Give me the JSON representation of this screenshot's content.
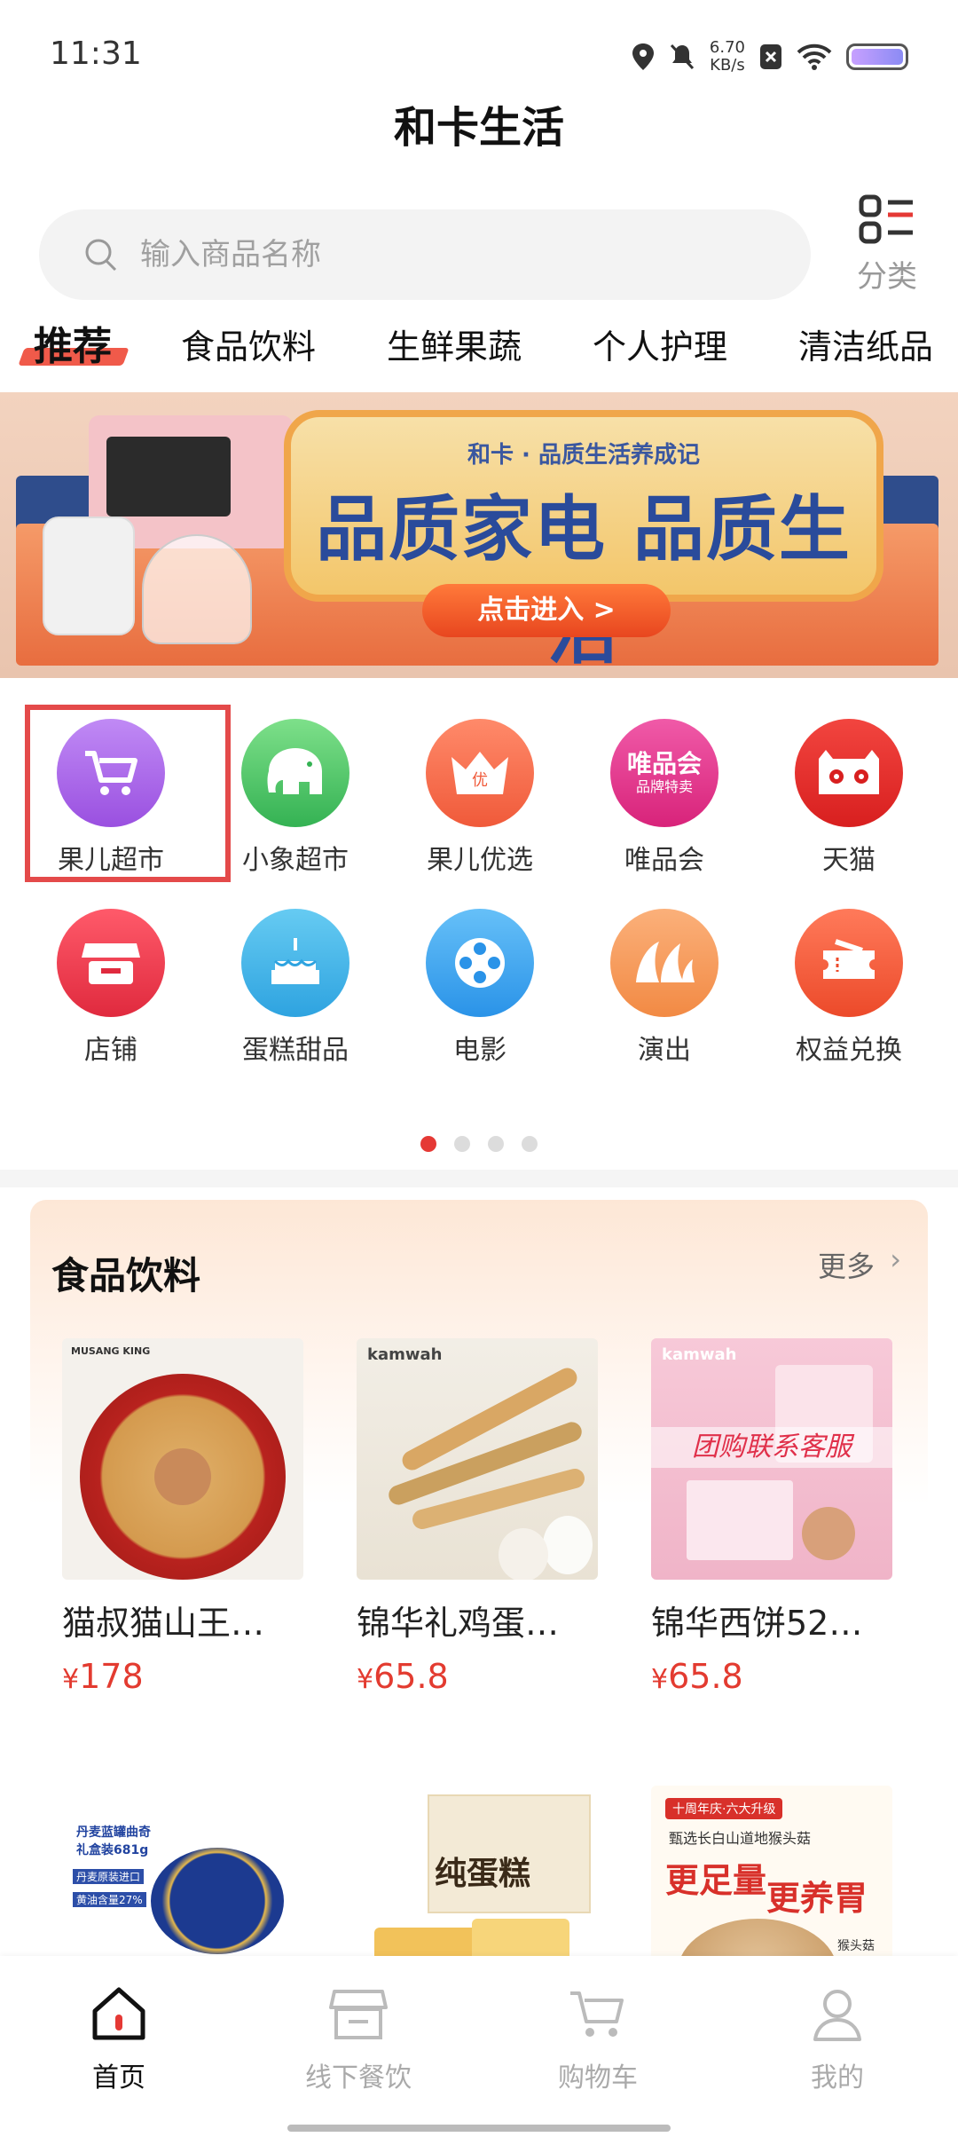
{
  "status_bar": {
    "time": "11:31",
    "speed_value": "6.70",
    "speed_unit": "KB/s"
  },
  "app": {
    "title": "和卡生活"
  },
  "search": {
    "placeholder": "输入商品名称"
  },
  "category_button": {
    "label": "分类"
  },
  "tabs": [
    {
      "label": "推荐",
      "active": true
    },
    {
      "label": "食品饮料"
    },
    {
      "label": "生鲜果蔬"
    },
    {
      "label": "个人护理"
    },
    {
      "label": "清洁纸品"
    }
  ],
  "banner": {
    "subtitle": "和卡 · 品质生活养成记",
    "headline": "品质家电 品质生活",
    "cta": "点击进入 >"
  },
  "grid": [
    {
      "label": "果儿超市",
      "icon": "shopping-cart-icon",
      "color": "#a45ee8"
    },
    {
      "label": "小象超市",
      "icon": "elephant-icon",
      "color": "#4fc66a"
    },
    {
      "label": "果儿优选",
      "icon": "crown-icon",
      "color": "#ff6a45"
    },
    {
      "label": "唯品会",
      "icon": "vip-icon",
      "color": "#e6398e",
      "icon_text": "唯品会",
      "icon_subtext": "品牌特卖"
    },
    {
      "label": "天猫",
      "icon": "tmall-icon",
      "color": "#ea2e2e"
    },
    {
      "label": "店铺",
      "icon": "store-icon",
      "color": "#ef3d4f"
    },
    {
      "label": "蛋糕甜品",
      "icon": "cake-icon",
      "color": "#3db3ea"
    },
    {
      "label": "电影",
      "icon": "film-reel-icon",
      "color": "#3aa6f0"
    },
    {
      "label": "演出",
      "icon": "opera-house-icon",
      "color": "#f59a56"
    },
    {
      "label": "权益兑换",
      "icon": "ticket-icon",
      "color": "#f25a3c"
    }
  ],
  "carousel": {
    "pages": 4,
    "active_page": 1
  },
  "food_section": {
    "title": "食品饮料",
    "more": "更多",
    "products": [
      {
        "name": "猫叔猫山王…",
        "currency": "¥",
        "price": "178"
      },
      {
        "name": "锦华礼鸡蛋…",
        "currency": "¥",
        "price": "65.8"
      },
      {
        "name": "锦华西饼52…",
        "currency": "¥",
        "price": "65.8"
      }
    ],
    "product_image_texts": {
      "brand1": "MUSANG KING",
      "brand2": "kamwah",
      "brand3": "kamwah",
      "promo3": "团购联系客服",
      "item4_line1": "丹麦蓝罐曲奇",
      "item4_line2": "礼盒装681g",
      "item4_tag1": "丹麦原装进口",
      "item4_tag2": "黄油含量27%",
      "item5_text": "纯蛋糕",
      "item6_tag": "十周年庆·六大升级",
      "item6_sub": "甄选长白山道地猴头菇",
      "item6_main1": "更足量",
      "item6_main2": "更养胃",
      "item6_label": "猴头菇"
    }
  },
  "bottom_nav": [
    {
      "label": "首页",
      "icon": "home-icon",
      "active": true
    },
    {
      "label": "线下餐饮",
      "icon": "storefront-icon"
    },
    {
      "label": "购物车",
      "icon": "cart-icon"
    },
    {
      "label": "我的",
      "icon": "user-icon"
    }
  ]
}
